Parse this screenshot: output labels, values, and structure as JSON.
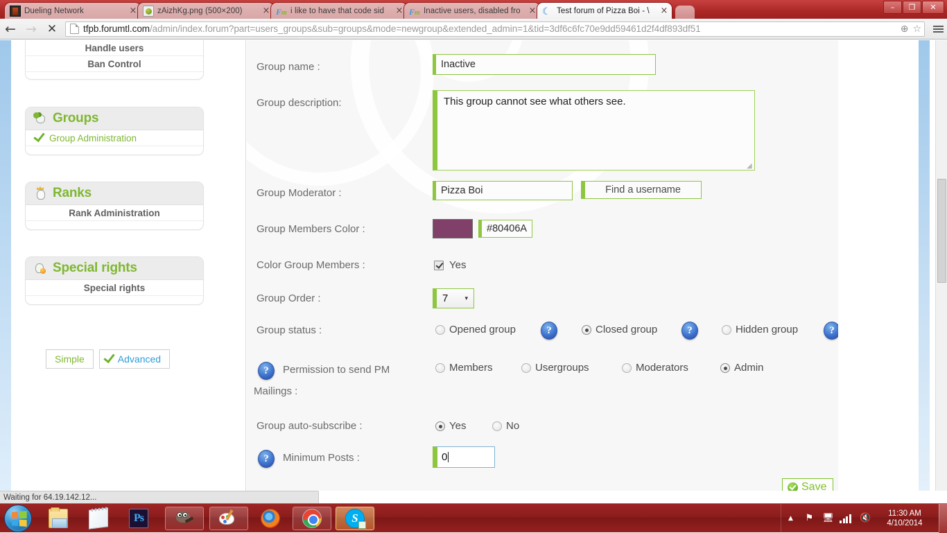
{
  "browser": {
    "tabs": [
      {
        "title": "Dueling Network",
        "favicon": "card-icon",
        "active": false
      },
      {
        "title": "zAizhKg.png (500×200)",
        "favicon": "image-icon",
        "active": false
      },
      {
        "title": "i like to have that code sid",
        "favicon": "forumotion-icon",
        "active": false
      },
      {
        "title": "Inactive users, disabled fro",
        "favicon": "forumotion-icon",
        "active": false
      },
      {
        "title": "Test forum of Pizza Boi - \\",
        "favicon": "moon-icon",
        "active": true
      }
    ],
    "close_glyph": "×",
    "nav": {
      "back": "←",
      "forward": "→",
      "stop": "✕"
    },
    "url_host": "tfpb.forumtl.com",
    "url_path": "/admin/index.forum?part=users_groups&sub=groups&mode=newgroup&extended_admin=1&tid=3df6c6fc70e9dd59461d2f4df893df51",
    "omnibox_zoom_icon": "⊕",
    "omnibox_star_icon": "☆",
    "window_controls": {
      "minimize": "–",
      "maximize": "❐",
      "close": "✕"
    },
    "status_text": "Waiting for 64.19.142.12..."
  },
  "sidebar": {
    "users_panel": {
      "items": [
        {
          "label": "Handle users"
        },
        {
          "label": "Ban Control"
        }
      ]
    },
    "groups_panel": {
      "title": "Groups",
      "icon": "groups-icon",
      "items": [
        {
          "label": "Group Administration",
          "icon": "green-check-icon",
          "active": true
        }
      ]
    },
    "ranks_panel": {
      "title": "Ranks",
      "icon": "ranks-icon",
      "items": [
        {
          "label": "Rank Administration"
        }
      ]
    },
    "special_panel": {
      "title": "Special rights",
      "icon": "special-rights-icon",
      "items": [
        {
          "label": "Special rights"
        }
      ]
    },
    "mode_buttons": {
      "simple": "Simple",
      "advanced": "Advanced",
      "advanced_icon": "green-check-icon"
    }
  },
  "form": {
    "group_name": {
      "label": "Group name :",
      "value": "Inactive"
    },
    "group_description": {
      "label": "Group description:",
      "value": "This group cannot see what others see."
    },
    "group_moderator": {
      "label": "Group Moderator :",
      "value": "Pizza Boi",
      "find_button": "Find a username"
    },
    "group_members_color": {
      "label": "Group Members Color :",
      "value": "#80406A",
      "swatch_color": "#80406A"
    },
    "color_group_members": {
      "label": "Color Group Members :",
      "option": "Yes",
      "checked": true
    },
    "group_order": {
      "label": "Group Order :",
      "value": "7",
      "caret": "▾"
    },
    "group_status": {
      "label": "Group status :",
      "help_glyph": "?",
      "options": [
        {
          "label": "Opened group",
          "selected": false
        },
        {
          "label": "Closed group",
          "selected": true
        },
        {
          "label": "Hidden group",
          "selected": false
        }
      ]
    },
    "pm_permission": {
      "label_line1": "Permission to send PM",
      "label_line2": "Mailings :",
      "help_glyph": "?",
      "options": [
        {
          "label": "Members",
          "selected": false
        },
        {
          "label": "Usergroups",
          "selected": false
        },
        {
          "label": "Moderators",
          "selected": false
        },
        {
          "label": "Admin",
          "selected": true
        }
      ]
    },
    "auto_subscribe": {
      "label": "Group auto-subscribe :",
      "options": [
        {
          "label": "Yes",
          "selected": true
        },
        {
          "label": "No",
          "selected": false
        }
      ]
    },
    "minimum_posts": {
      "label": "Minimum Posts :",
      "help_glyph": "?",
      "value": "0"
    },
    "save_button": {
      "label": "Save",
      "icon": "green-check-circle-icon"
    }
  },
  "taskbar": {
    "start": "start-orb",
    "items": [
      {
        "name": "windows-explorer",
        "state": "pinned"
      },
      {
        "name": "sticky-notes",
        "state": "pinned"
      },
      {
        "name": "photoshop",
        "state": "pinned",
        "label": "Ps"
      },
      {
        "name": "gimp",
        "state": "running"
      },
      {
        "name": "paint",
        "state": "running"
      },
      {
        "name": "firefox",
        "state": "pinned"
      },
      {
        "name": "chrome",
        "state": "running"
      },
      {
        "name": "skype",
        "state": "active",
        "label": "S"
      }
    ],
    "tray": {
      "show_hidden": "▲",
      "flag_icon": "action-center-flag-icon",
      "network_icon": "network-icon",
      "signal_icon": "signal-bars-icon",
      "volume_icon": "volume-muted-icon",
      "time": "11:30 AM",
      "date": "4/10/2014"
    }
  }
}
